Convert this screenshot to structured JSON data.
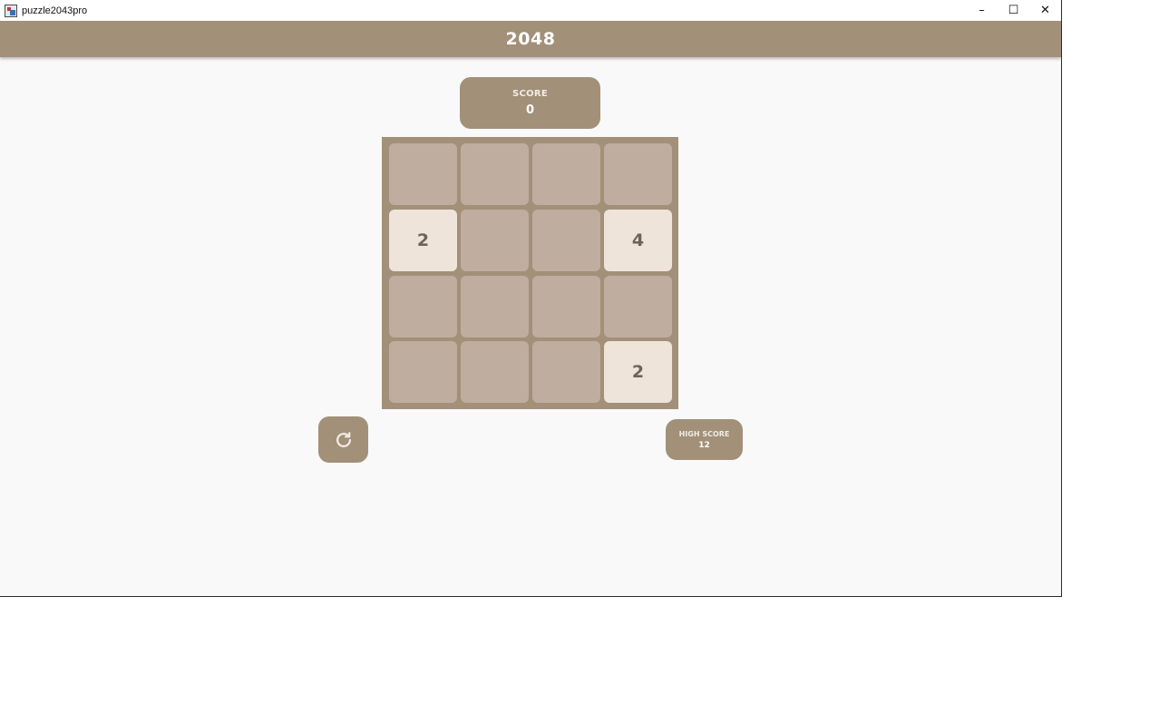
{
  "window": {
    "title": "puzzle2043pro"
  },
  "controls": {
    "minimize": "–",
    "maximize": "☐",
    "close": "✕"
  },
  "header": {
    "title": "2048"
  },
  "score": {
    "label": "SCORE",
    "value": "0"
  },
  "board": {
    "rows": [
      [
        "",
        "",
        "",
        ""
      ],
      [
        "2",
        "",
        "",
        "4"
      ],
      [
        "",
        "",
        "",
        ""
      ],
      [
        "",
        "",
        "",
        "2"
      ]
    ]
  },
  "restart": {
    "icon": "refresh-icon"
  },
  "high_score": {
    "label": "HIGH SCORE",
    "value": "12"
  },
  "colors": {
    "accent": "#a29079",
    "empty_cell": "#bfae9f",
    "tile_2_4": "#eee4da",
    "tile_text": "#6f6357",
    "background": "#f9f9f9"
  }
}
